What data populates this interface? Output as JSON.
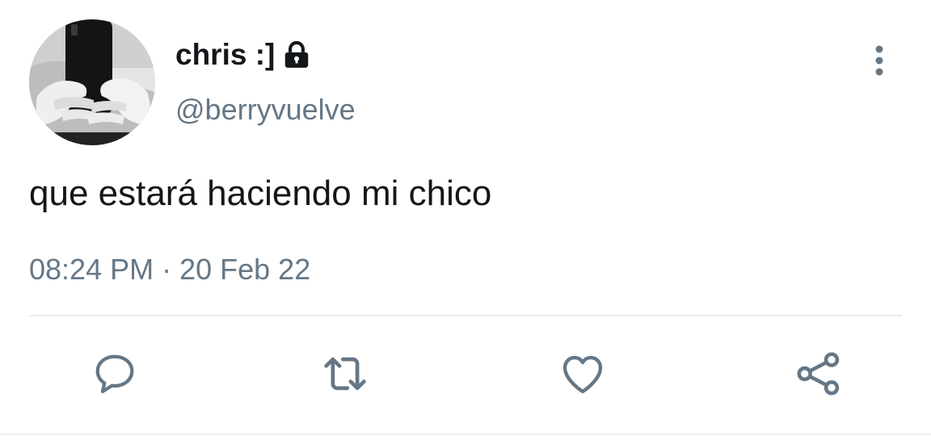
{
  "tweet": {
    "display_name": "chris :]",
    "handle": "@berryvuelve",
    "text": "que estará haciendo mi chico",
    "time": "08:24 PM",
    "separator": "·",
    "date": "20 Feb 22"
  },
  "icons": {
    "lock": "lock-icon",
    "more": "vertical-dots-icon",
    "reply": "speech-bubble-icon",
    "retweet": "retweet-arrows-icon",
    "like": "heart-outline-icon",
    "share": "share-nodes-icon"
  },
  "colors": {
    "text_primary": "#14171a",
    "text_secondary": "#657786",
    "divider": "#e6ecf0"
  }
}
